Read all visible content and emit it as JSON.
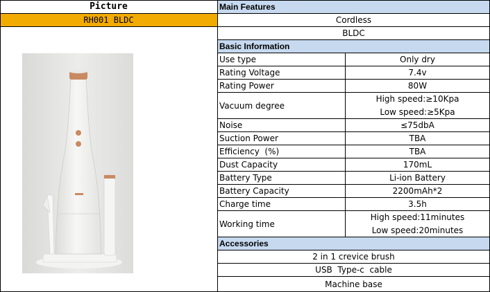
{
  "picture": {
    "header": "Picture",
    "model": "RH001 BLDC",
    "model_bg": "#f2ab00",
    "image_caption": "handheld vacuum cleaner product photo"
  },
  "main_features": {
    "title": "Main Features",
    "items": [
      "Cordless",
      "BLDC"
    ]
  },
  "basic_information": {
    "title": "Basic Information",
    "rows": [
      {
        "label": "Use type",
        "value": "Only dry"
      },
      {
        "label": "Rating Voltage",
        "value": "7.4v"
      },
      {
        "label": "Rating Power",
        "value": "80W"
      },
      {
        "label": "Vacuum degree",
        "values": [
          "High speed:≥10Kpa",
          "Low speed:≥5Kpa"
        ]
      },
      {
        "label": "Noise",
        "value": "≤75dbA"
      },
      {
        "label": "Suction Power",
        "value": "TBA"
      },
      {
        "label": "Efficiency  (%)",
        "value": "TBA"
      },
      {
        "label": "Dust Capacity",
        "value": "170mL"
      },
      {
        "label": "Battery Type",
        "value": "Li-ion Battery"
      },
      {
        "label": "Battery Capacity",
        "value": "2200mAh*2"
      },
      {
        "label": "Charge time",
        "value": "3.5h"
      },
      {
        "label": "Working time",
        "values": [
          "High speed:11minutes",
          "Low speed:20minutes"
        ]
      }
    ]
  },
  "accessories": {
    "title": "Accessories",
    "items": [
      "2 in 1 crevice brush",
      "USB  Type-c  cable",
      "Machine base"
    ]
  },
  "colors": {
    "section_bg": "#c6d9ef",
    "model_bg": "#f2ab00",
    "product_body": "#efefec",
    "accent": "#c98a62"
  }
}
